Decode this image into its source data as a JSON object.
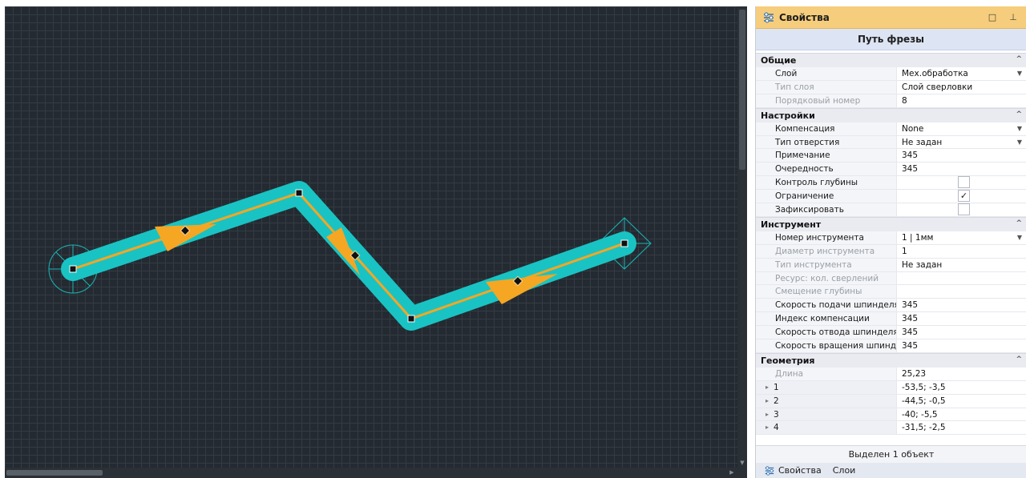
{
  "panel": {
    "title": "Свойства",
    "object_title": "Путь фрезы",
    "status": "Выделен 1 объект",
    "header_buttons": [
      "maximize-icon",
      "pin-icon"
    ],
    "accent_color": "#f6cd7c"
  },
  "categories": {
    "general": {
      "label": "Общие",
      "rows": {
        "layer": {
          "name": "Слой",
          "value": "Мех.обработка"
        },
        "layer_type": {
          "name": "Тип слоя",
          "value": "Слой сверловки"
        },
        "order_num": {
          "name": "Порядковый номер",
          "value": "8"
        }
      }
    },
    "settings": {
      "label": "Настройки",
      "rows": {
        "compensation": {
          "name": "Компенсация",
          "value": "None"
        },
        "hole_type": {
          "name": "Тип отверстия",
          "value": "Не задан"
        },
        "note": {
          "name": "Примечание",
          "value": "345"
        },
        "sequence": {
          "name": "Очередность",
          "value": "345"
        },
        "depth_control": {
          "name": "Контроль глубины",
          "checked": false
        },
        "limit": {
          "name": "Ограничение",
          "checked": true,
          "check_glyph": "✓"
        },
        "fix": {
          "name": "Зафиксировать",
          "checked": false
        }
      }
    },
    "tool": {
      "label": "Инструмент",
      "rows": {
        "tool_num": {
          "name": "Номер инструмента",
          "value": "1 | 1мм"
        },
        "tool_diam": {
          "name": "Диаметр инструмента",
          "value": "1"
        },
        "tool_type": {
          "name": "Тип инструмента",
          "value": "Не задан"
        },
        "resource": {
          "name": "Ресурс: кол. сверлений",
          "value": ""
        },
        "depth_offset": {
          "name": "Смещение глубины",
          "value": ""
        },
        "feed_speed": {
          "name": "Скорость подачи шпинделя",
          "value": "345"
        },
        "comp_index": {
          "name": "Индекс компенсации",
          "value": "345"
        },
        "retract_speed": {
          "name": "Скорость отвода шпинделя",
          "value": "345"
        },
        "rotation_speed": {
          "name": "Скорость вращения шпинд...",
          "value": "345"
        }
      }
    },
    "geometry": {
      "label": "Геометрия",
      "rows": {
        "length": {
          "name": "Длина",
          "value": "25,23"
        },
        "p1": {
          "name": "1",
          "value": "-53,5; -3,5"
        },
        "p2": {
          "name": "2",
          "value": "-44,5; -0,5"
        },
        "p3": {
          "name": "3",
          "value": "-40; -5,5"
        },
        "p4": {
          "name": "4",
          "value": "-31,5; -2,5"
        }
      }
    }
  },
  "tabs": [
    {
      "label": "Свойства",
      "icon": "properties-icon"
    },
    {
      "label": "Слои"
    }
  ],
  "canvas": {
    "background": "#242a31",
    "path_color": "#19c3c3",
    "tool_line_color": "#f5a623",
    "vertices": [
      "vertex-1",
      "vertex-2",
      "vertex-3",
      "vertex-4"
    ]
  }
}
